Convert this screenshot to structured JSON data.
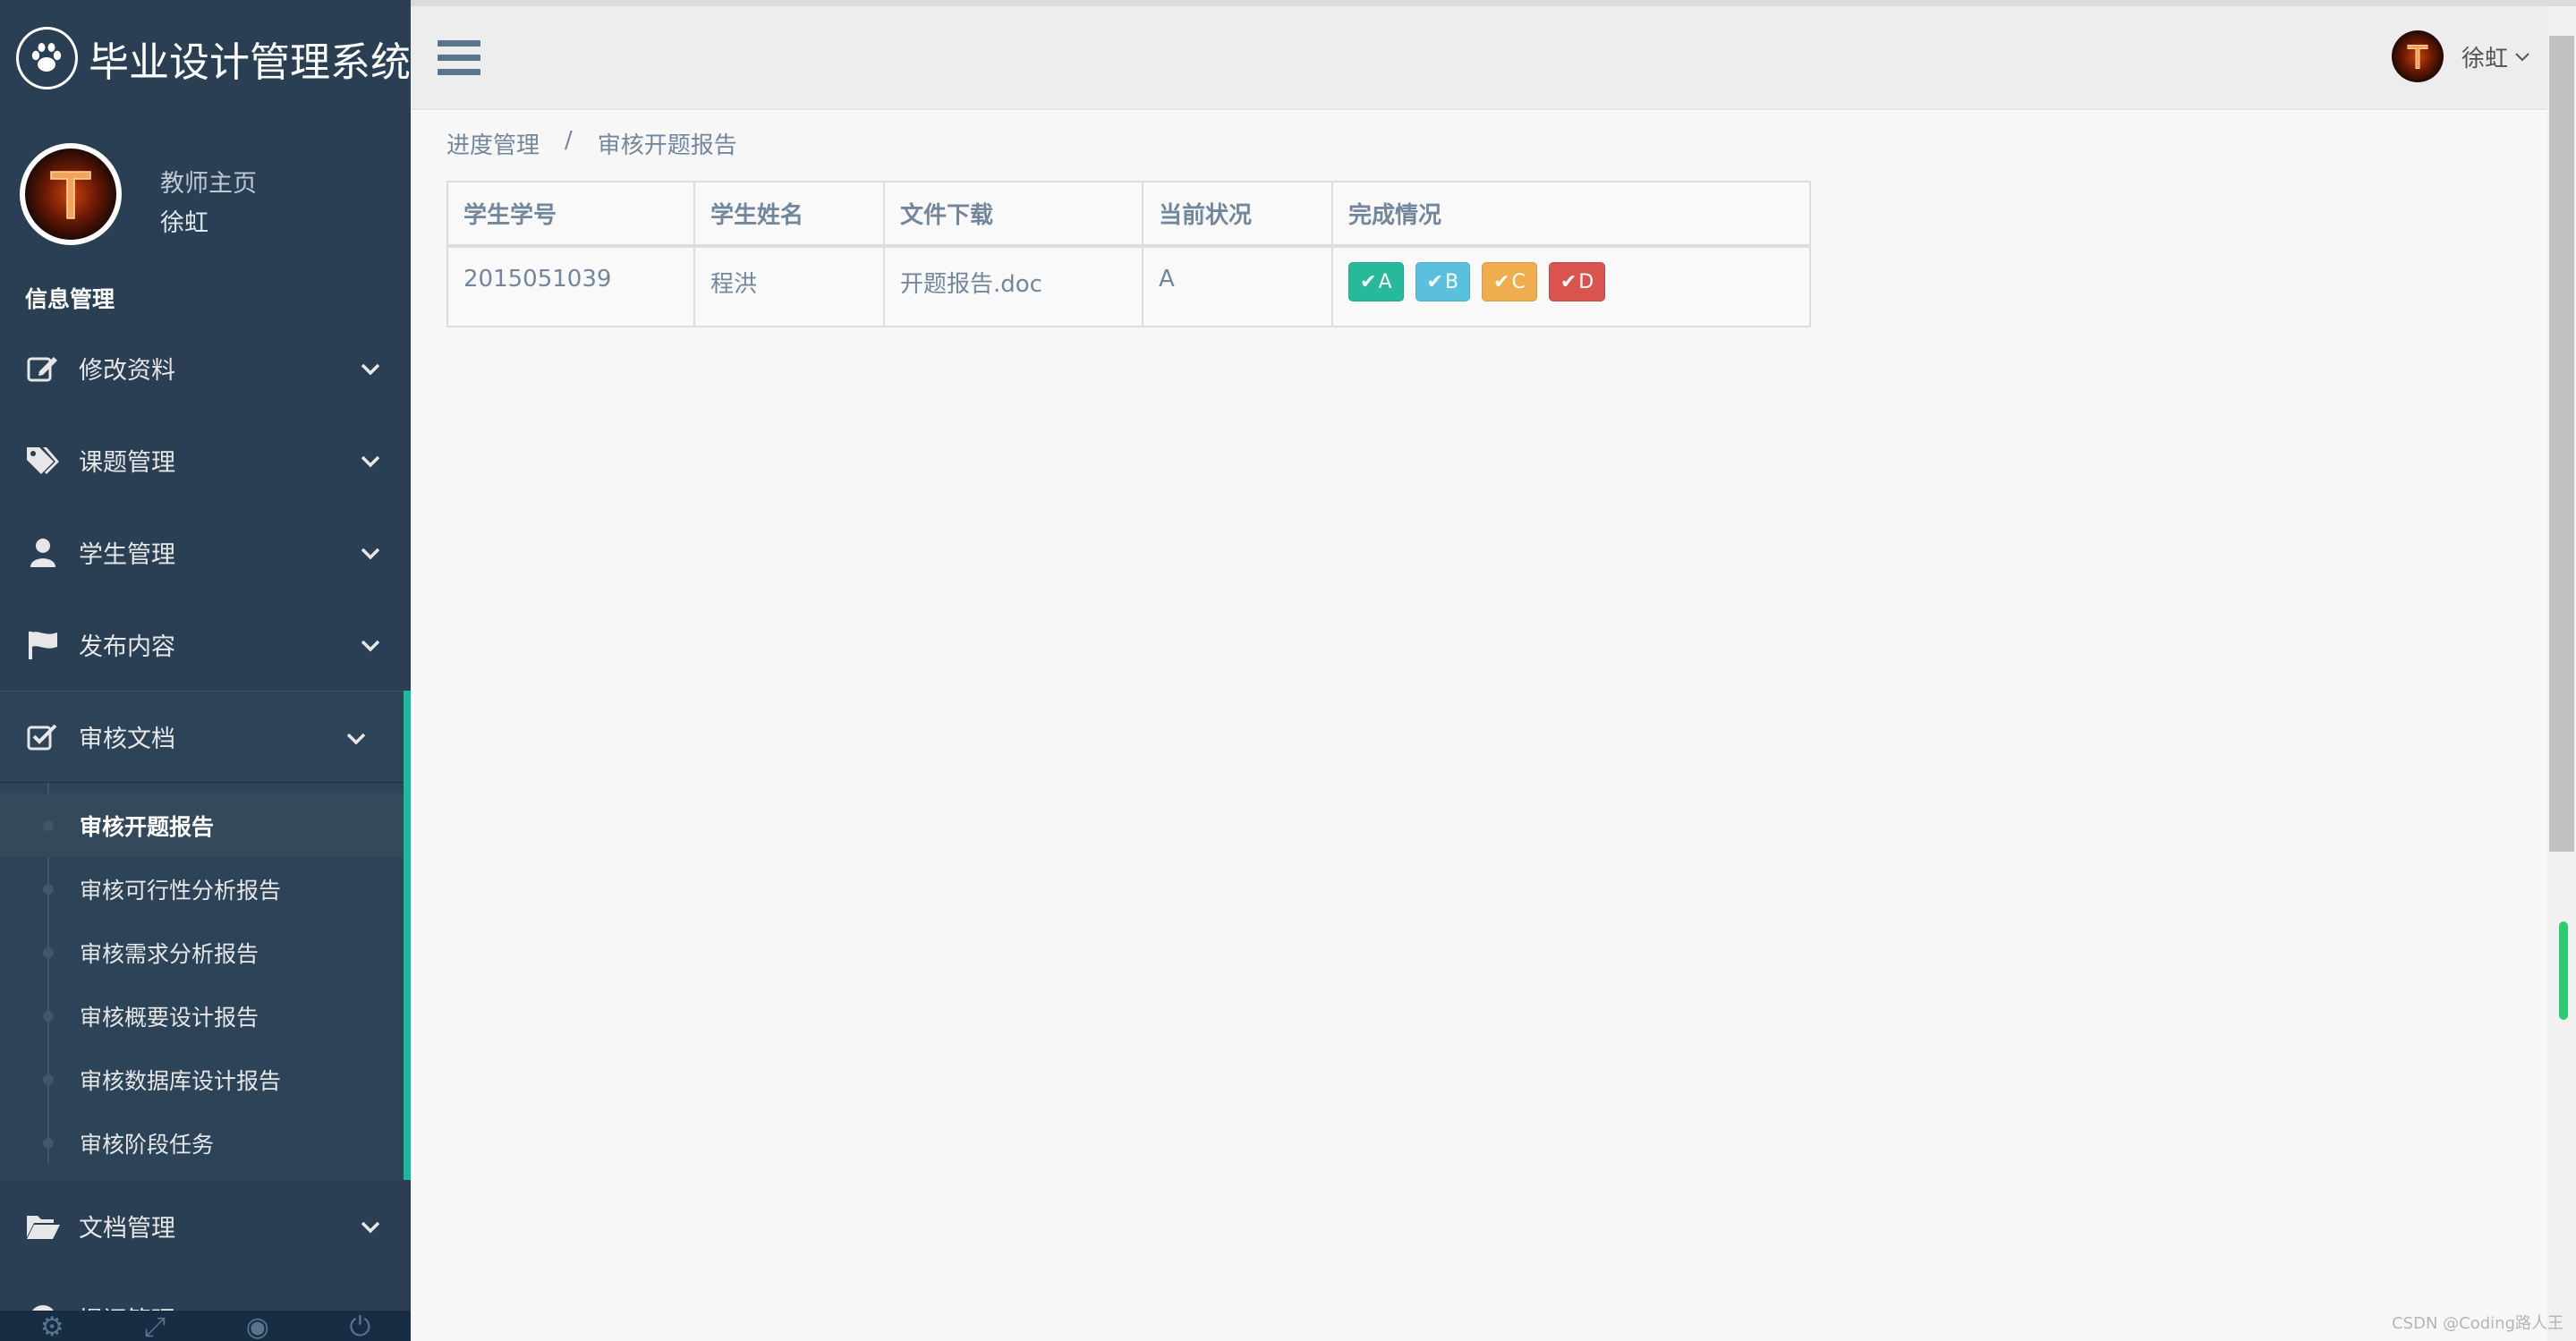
{
  "app": {
    "title": "毕业设计管理系统"
  },
  "profile": {
    "role": "教师主页",
    "name": "徐虹"
  },
  "sidebar": {
    "section_title": "信息管理",
    "items": [
      {
        "label": "修改资料",
        "icon": "edit-icon"
      },
      {
        "label": "课题管理",
        "icon": "tags-icon"
      },
      {
        "label": "学生管理",
        "icon": "user-icon"
      },
      {
        "label": "发布内容",
        "icon": "flag-icon"
      }
    ],
    "active_item": {
      "label": "审核文档",
      "icon": "check-square-icon",
      "children": [
        {
          "label": "审核开题报告",
          "current": true
        },
        {
          "label": "审核可行性分析报告"
        },
        {
          "label": "审核需求分析报告"
        },
        {
          "label": "审核概要设计报告"
        },
        {
          "label": "审核数据库设计报告"
        },
        {
          "label": "审核阶段任务"
        }
      ]
    },
    "after_items": [
      {
        "label": "文档管理",
        "icon": "folder-open-icon"
      },
      {
        "label": "提问管理",
        "icon": "question-icon"
      }
    ]
  },
  "topbar": {
    "user_name": "徐虹"
  },
  "breadcrumb": {
    "items": [
      "进度管理",
      "审核开题报告"
    ],
    "separator": "/"
  },
  "table": {
    "headers": [
      "学生学号",
      "学生姓名",
      "文件下载",
      "当前状况",
      "完成情况"
    ],
    "rows": [
      {
        "student_id": "2015051039",
        "student_name": "程洪",
        "file": "开题报告.doc",
        "status": "A"
      }
    ],
    "grade_buttons": [
      {
        "label": "A",
        "color": "#26b99a"
      },
      {
        "label": "B",
        "color": "#5bc0de"
      },
      {
        "label": "C",
        "color": "#f0ad4e"
      },
      {
        "label": "D",
        "color": "#d9534f"
      }
    ]
  },
  "colors": {
    "sidebar_bg": "#2a3f54",
    "accent": "#1abb9c",
    "topbar_bg": "#ededed",
    "main_bg": "#f7f7f7",
    "text_muted": "#73879c"
  },
  "watermark": "CSDN @Coding路人王"
}
